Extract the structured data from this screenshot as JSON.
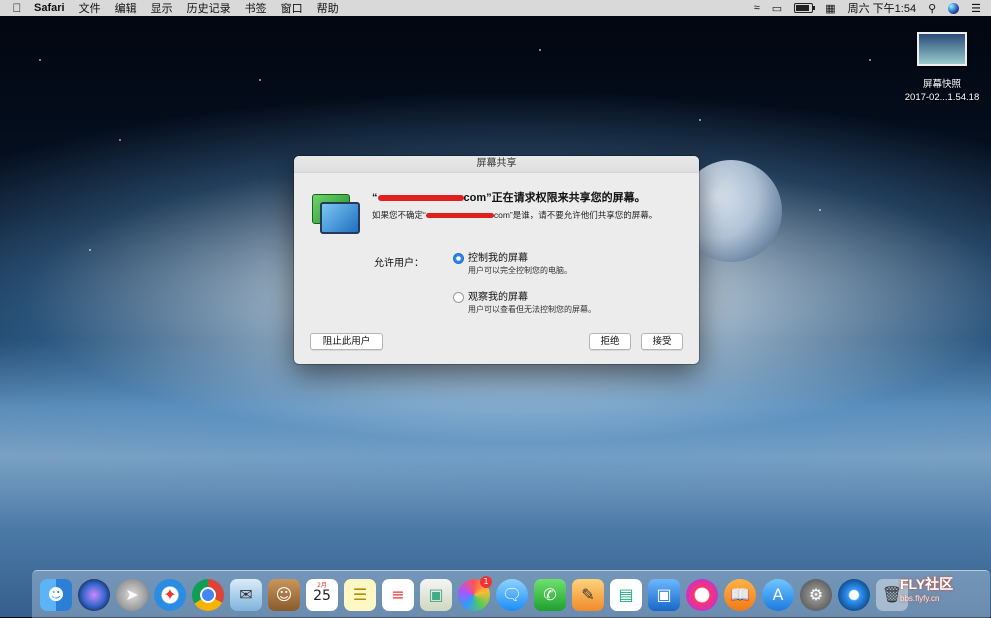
{
  "menubar": {
    "app": "Safari",
    "menus": [
      "文件",
      "编辑",
      "显示",
      "历史记录",
      "书签",
      "窗口",
      "帮助"
    ],
    "clock": "周六 下午1:54"
  },
  "desktop_item": {
    "name": "屏幕快照",
    "date": "2017-02...1.54.18"
  },
  "dialog": {
    "title": "屏幕共享",
    "heading_open": "“",
    "heading_visible_end": "com”正在请求权限来共享您的屏幕。",
    "sub_start": "如果您不确定“",
    "sub_end": "com”是谁，请不要允许他们共享您的屏幕。",
    "allow_label": "允许用户：",
    "options": [
      {
        "title": "控制我的屏幕",
        "desc": "用户可以完全控制您的电脑。",
        "selected": true
      },
      {
        "title": "观察我的屏幕",
        "desc": "用户可以查看但无法控制您的屏幕。",
        "selected": false
      }
    ],
    "buttons": {
      "block": "阻止此用户",
      "decline": "拒绝",
      "accept": "接受"
    }
  },
  "dock": {
    "calendar_day": "25",
    "photos_badge": "1"
  },
  "watermark": {
    "title": "FLY社区",
    "site": "bbs.flyfy.cn"
  }
}
